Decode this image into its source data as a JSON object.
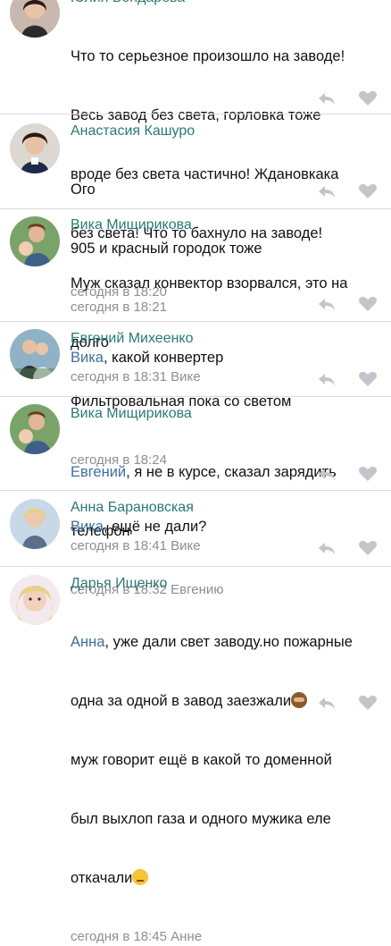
{
  "comments": [
    {
      "author": "Юлия Бондарева",
      "text_lines": [
        "Что то серьезное произошло на заводе!",
        "Весь завод без света, горловка тоже",
        "вроде без света частично! Ждановкака",
        "без света! Что то бахнуло на заводе!"
      ],
      "time": "сегодня в 18:20"
    },
    {
      "author": "Анастасия Кашуро",
      "text_lines": [
        "Ого",
        "905 и красный городок тоже"
      ],
      "time": "сегодня в 18:21"
    },
    {
      "author": "Вика Мищирикова",
      "text_lines": [
        "Муж сказал конвектор взорвался, это на",
        "долго",
        "Фильтровальная пока со светом"
      ],
      "time": "сегодня в 18:24"
    },
    {
      "author": "Евгений Михеенко",
      "mention": "Вика",
      "text_after_mention": ", какой конвертер",
      "time": "сегодня в 18:31 Вике"
    },
    {
      "author": "Вика Мищирикова",
      "mention": "Евгений",
      "text_after_mention": ", я не в курсе, сказал зарядить",
      "text_lines": [
        "телефон"
      ],
      "time": "сегодня в 18:32 Евгению"
    },
    {
      "author": "Анна Барановская",
      "mention": "Вика",
      "text_after_mention": ", ещё не дали?",
      "time": "сегодня в 18:41 Вике"
    },
    {
      "author": "Дарья Ищенко",
      "mention": "Анна",
      "text_after_mention": ", уже дали свет заводу.но пожарные",
      "text_lines": [
        "одна за одной в завод заезжали",
        "муж говорит ещё в какой то доменной",
        "был выхлоп газа и одного мужика еле",
        "откачали"
      ],
      "emojis": [
        "see-no-evil-monkey-emoji",
        "pensive-face-emoji"
      ],
      "time": "сегодня в 18:45 Анне"
    }
  ],
  "colors": {
    "name": "#2a7a72",
    "mention": "#3e6f9c",
    "meta": "#8e8e93",
    "divider": "#dcdcdc"
  },
  "icons": {
    "reply": "reply-arrow-icon",
    "like": "heart-icon"
  }
}
